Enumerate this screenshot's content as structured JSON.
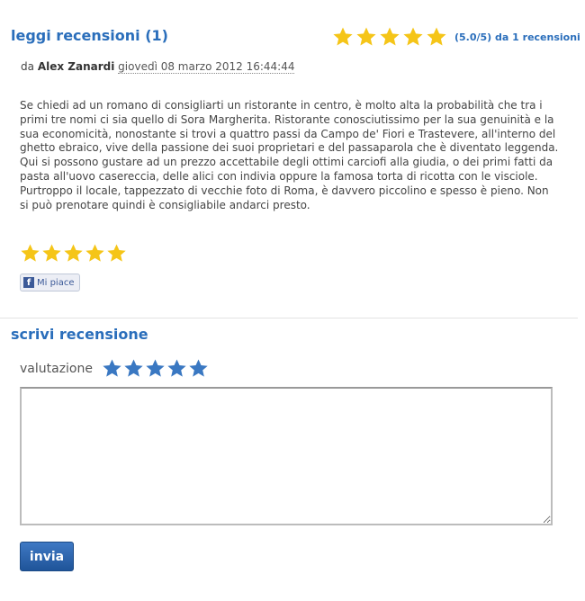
{
  "read": {
    "title": "leggi recensioni (1)",
    "summary_stars": 5,
    "summary_text": "(5.0/5) da 1 recensioni"
  },
  "review": {
    "by_label": "da",
    "author": "Alex Zanardi",
    "date": "giovedì 08 marzo 2012 16:44:44",
    "text": "Se chiedi ad un romano di consigliarti un ristorante in centro, è molto alta la probabilità che tra i primi tre nomi ci sia quello di Sora Margherita. Ristorante conosciutissimo per la sua genuinità e la sua economicità, nonostante si trovi a quattro passi da Campo de' Fiori e Trastevere, all'interno del ghetto ebraico, vive della passione dei suoi proprietari e del passaparola che è diventato leggenda. Qui si possono gustare ad un prezzo accettabile degli ottimi carciofi alla giudia, o dei primi fatti da pasta all'uovo casereccia, delle alici con indivia oppure la famosa torta di ricotta con le visciole. Purtroppo il locale, tappezzato di vecchie foto di Roma, è davvero piccolino e spesso è pieno. Non si può prenotare quindi è consigliabile andarci presto.",
    "stars": 5,
    "like_label": "Mi piace",
    "like_icon": "f"
  },
  "write": {
    "title": "scrivi recensione",
    "rating_label": "valutazione",
    "rating_stars": 5,
    "textarea_value": "",
    "submit_label": "invia"
  },
  "colors": {
    "accent": "#2a6ebb",
    "star_gold": "#f5c518",
    "star_blue": "#3a78c2",
    "button": "#2a5fa8"
  }
}
